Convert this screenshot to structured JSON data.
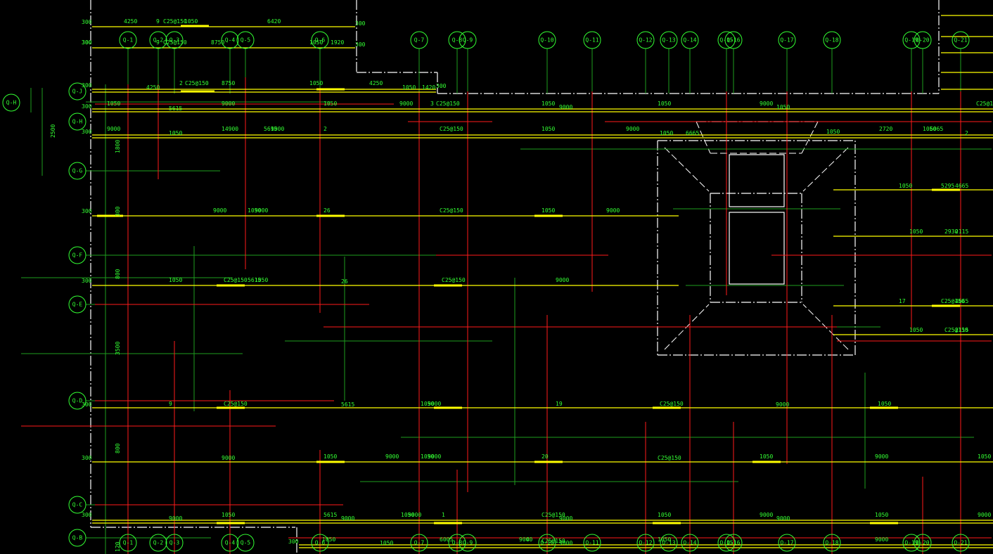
{
  "colors": {
    "background": "#000000",
    "grid_bubble": "#33ff33",
    "annotation_text": "#33ff33",
    "rebar_top": "#ffff00",
    "rebar_bottom": "#ff1a1a",
    "dimension_line": "#1e9e1e",
    "outline": "#ffffff",
    "bar_tag": "#ffff00"
  },
  "grid_bubbles_top": [
    "Q-1",
    "Q-2",
    "Q-3",
    "Q-4",
    "Q-5",
    "Q-6",
    "Q-7",
    "Q-8",
    "Q-9",
    "Q-10",
    "Q-11",
    "Q-12",
    "Q-13",
    "Q-14",
    "Q-15",
    "Q-16",
    "Q-17",
    "Q-18",
    "Q-19",
    "Q-20",
    "Q-21"
  ],
  "grid_bubbles_bottom": [
    "Q-1",
    "Q-2",
    "Q-3",
    "Q-4",
    "Q-5",
    "Q-6",
    "Q-7",
    "Q-8",
    "Q-9",
    "Q-10",
    "Q-11",
    "Q-12",
    "Q-13",
    "Q-14",
    "Q-15",
    "Q-16",
    "Q-17",
    "Q-18",
    "Q-19",
    "Q-20",
    "Q-21"
  ],
  "grid_bubbles_left": [
    "Q-H",
    "Q-J",
    "Q-H",
    "Q-G",
    "Q-F",
    "Q-E",
    "Q-D",
    "Q-C",
    "Q-B"
  ],
  "dimensions_left": [
    "300",
    "300",
    "300",
    "300",
    "300",
    "300",
    "300",
    "300",
    "300",
    "300",
    "300",
    "2500",
    "1800",
    "300",
    "800",
    "3500",
    "800",
    "120"
  ],
  "annotations": [
    "4250",
    "9",
    "C25@150",
    "1050",
    "6420",
    "300",
    "300",
    "9",
    "C25@150",
    "8750",
    "1050",
    "1920",
    "300",
    "4250",
    "2",
    "C25@150",
    "8750",
    "1050",
    "4250",
    "1050",
    "1420",
    "300",
    "1050",
    "5615",
    "9000",
    "1050",
    "9000",
    "3",
    "C25@150",
    "1050",
    "9000",
    "1050",
    "9000",
    "1050",
    "9000",
    "1050",
    "14900",
    "5615",
    "9000",
    "2",
    "C25@150",
    "1050",
    "9000",
    "1050",
    "6665",
    "1050",
    "2720",
    "1050",
    "6065",
    "2",
    "C25@150",
    "9000",
    "1050",
    "9000",
    "26",
    "C25@150",
    "1050",
    "9000",
    "1050",
    "5295",
    "4665",
    "1050",
    "C25@150",
    "5615",
    "1050",
    "26",
    "C25@150",
    "9000",
    "1050",
    "2930",
    "2115",
    "17",
    "C25@150",
    "4665",
    "1050",
    "C25@150",
    "2115",
    "9",
    "C25@150",
    "5615",
    "1050",
    "9000",
    "19",
    "C25@150",
    "9000",
    "1050",
    "9000",
    "1050",
    "9000",
    "1050",
    "9000",
    "20",
    "C25@150",
    "1050",
    "9000",
    "1050",
    "9000",
    "1050",
    "5615",
    "9000",
    "1050",
    "9000",
    "1",
    "C25@150",
    "9000",
    "1050",
    "9000",
    "9000",
    "1050",
    "9000",
    "9000",
    "1050",
    "1050",
    "6005",
    "9000",
    "4",
    "C25@150",
    "9000",
    "1050",
    "9000",
    "9000"
  ]
}
